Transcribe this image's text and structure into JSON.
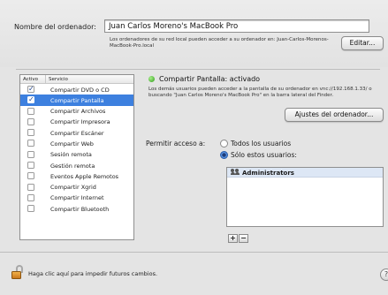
{
  "computer_name": {
    "label": "Nombre del ordenador:",
    "value": "Juan Carlos Moreno's MacBook Pro",
    "help": "Los ordenadores de su red local pueden acceder a su ordenador en: Juan-Carlos-Morenos-MacBook-Pro.local",
    "edit_button": "Editar..."
  },
  "services": {
    "header_on": "Activo",
    "header_service": "Servicio",
    "items": [
      {
        "label": "Compartir DVD o CD",
        "checked": true,
        "selected": false
      },
      {
        "label": "Compartir Pantalla",
        "checked": true,
        "selected": true
      },
      {
        "label": "Compartir Archivos",
        "checked": false,
        "selected": false
      },
      {
        "label": "Compartir Impresora",
        "checked": false,
        "selected": false
      },
      {
        "label": "Compartir Escáner",
        "checked": false,
        "selected": false
      },
      {
        "label": "Compartir Web",
        "checked": false,
        "selected": false
      },
      {
        "label": "Sesión remota",
        "checked": false,
        "selected": false
      },
      {
        "label": "Gestión remota",
        "checked": false,
        "selected": false
      },
      {
        "label": "Eventos Apple Remotos",
        "checked": false,
        "selected": false
      },
      {
        "label": "Compartir Xgrid",
        "checked": false,
        "selected": false
      },
      {
        "label": "Compartir Internet",
        "checked": false,
        "selected": false
      },
      {
        "label": "Compartir Bluetooth",
        "checked": false,
        "selected": false
      }
    ]
  },
  "detail": {
    "status": "Compartir Pantalla: activado",
    "status_color": "#2f9b1a",
    "description": "Los demás usuarios pueden acceder a la pantalla de su ordenador en vnc://192.168.1.33/ o buscando \"Juan Carlos Moreno's MacBook Pro\" en la barra lateral del Finder.",
    "settings_button": "Ajustes del ordenador...",
    "allow_label": "Permitir acceso a:",
    "option_all": "Todos los usuarios",
    "option_these": "Sólo estos usuarios:",
    "selected_option": "these",
    "users": [
      "Administrators"
    ],
    "add_button": "+",
    "remove_button": "−"
  },
  "footer": {
    "lock_text": "Haga clic aquí para impedir futuros cambios.",
    "help_button": "?"
  }
}
